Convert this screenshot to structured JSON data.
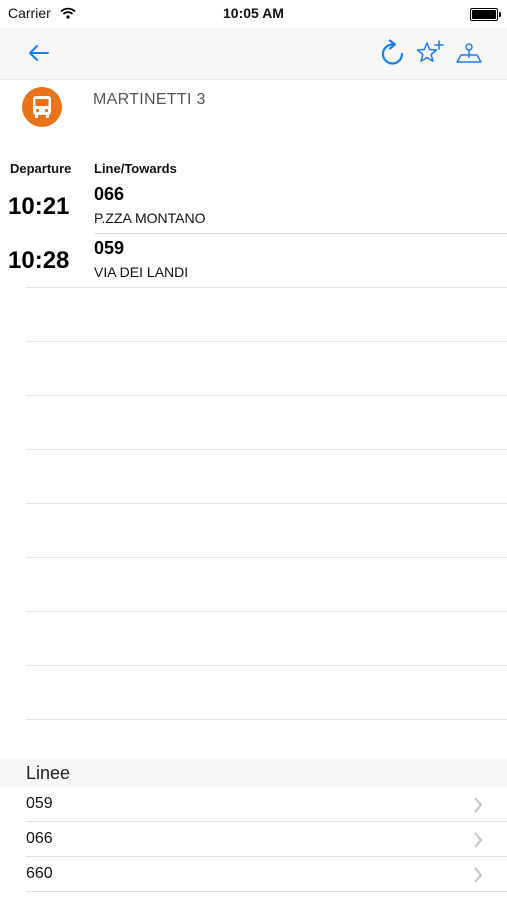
{
  "status_bar": {
    "carrier": "Carrier",
    "time": "10:05 AM"
  },
  "nav": {
    "back_icon": "back-arrow-icon",
    "actions": [
      "refresh-icon",
      "favorite-add-icon",
      "map-icon"
    ],
    "accent_color": "#1a7ef2"
  },
  "stop": {
    "name": "MARTINETTI 3",
    "icon": "bus-icon",
    "icon_color": "#e8731a"
  },
  "departures_table": {
    "header_departure": "Departure",
    "header_line": "Line/Towards",
    "rows": [
      {
        "time": "10:21",
        "line": "066",
        "towards": "P.ZZA MONTANO"
      },
      {
        "time": "10:28",
        "line": "059",
        "towards": "VIA DEI LANDI"
      }
    ]
  },
  "linee": {
    "title": "Linee",
    "items": [
      {
        "label": "059"
      },
      {
        "label": "066"
      },
      {
        "label": "660"
      }
    ]
  }
}
